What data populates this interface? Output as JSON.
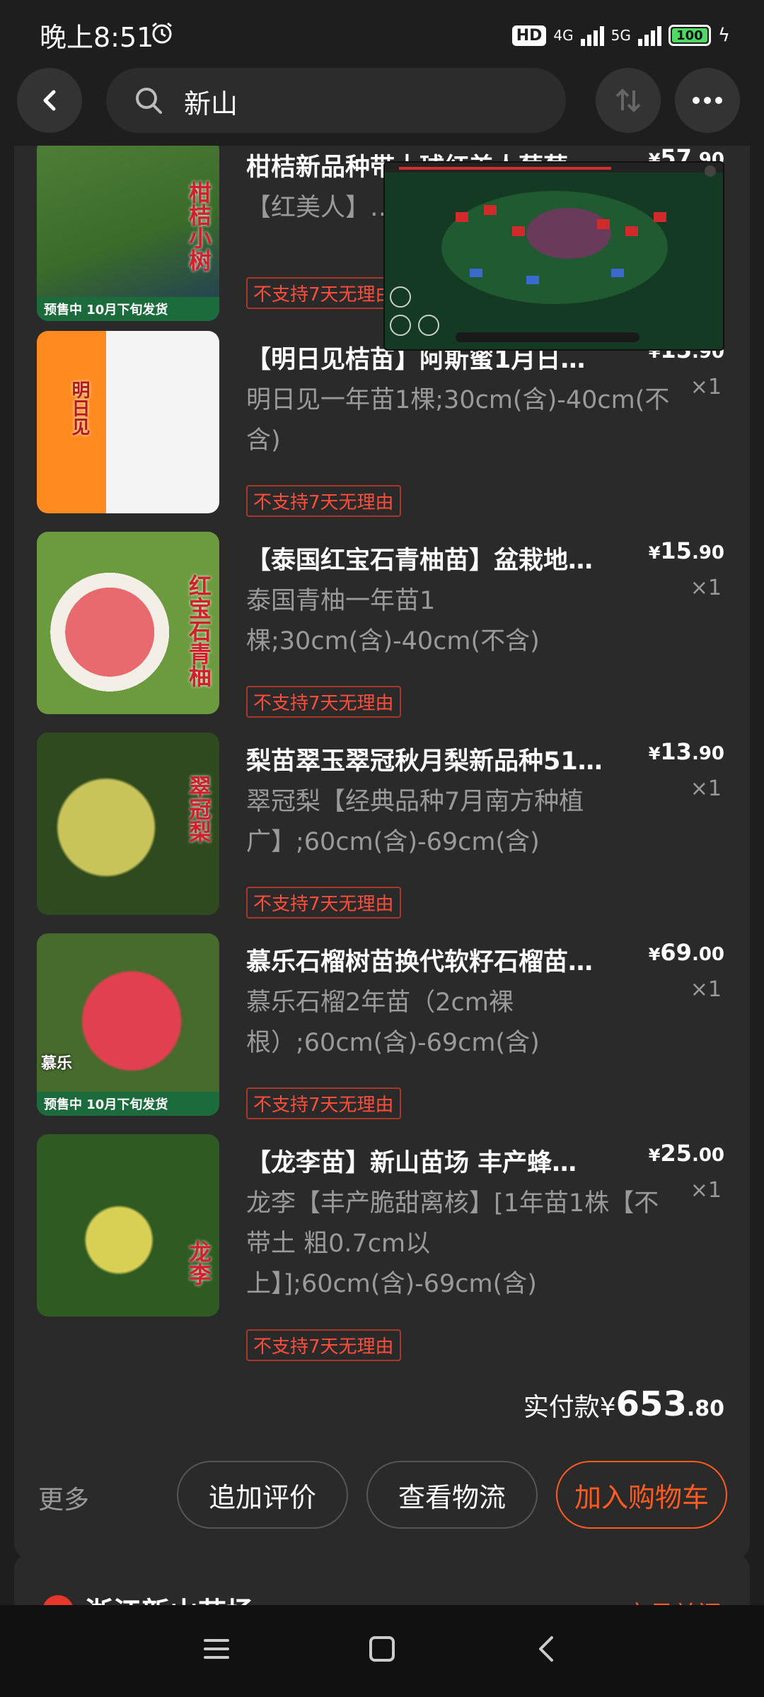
{
  "status": {
    "time": "晚上8:51",
    "hd": "HD",
    "net1": "4G",
    "net2": "5G",
    "battery": "100"
  },
  "search": {
    "query": "新山"
  },
  "items": [
    {
      "title": "柑桔新品种带土球红美人葡萄",
      "spec": "【红美人】…根;50cm(含)",
      "badge": "不支持7天无理由",
      "price_int": "57",
      "price_dec": ".90",
      "qty": "",
      "thumb_text": "柑桔小树",
      "presale": "预售中 10月下旬发货",
      "thumb_colors": [
        "#3e6b2c",
        "#1f3a5a"
      ]
    },
    {
      "title": "【明日见桔苗】阿斯蜜1月日…",
      "spec": "明日见一年苗1棵;30cm(含)-40cm(不含)",
      "badge": "不支持7天无理由",
      "price_int": "15",
      "price_dec": ".90",
      "qty": "×1",
      "thumb_text": "明日见",
      "presale": "",
      "thumb_colors": [
        "#f2f2f2",
        "#ff8a1f"
      ]
    },
    {
      "title": "【泰国红宝石青柚苗】盆栽地…",
      "spec": "泰国青柚一年苗1棵;30cm(含)-40cm(不含)",
      "badge": "不支持7天无理由",
      "price_int": "15",
      "price_dec": ".90",
      "qty": "×1",
      "thumb_text": "红宝石青柚",
      "presale": "",
      "thumb_colors": [
        "#e86a6e",
        "#5d8a3a"
      ]
    },
    {
      "title": "梨苗翠玉翠冠秋月梨新品种51…",
      "spec": "翠冠梨【经典品种7月南方种植广】;60cm(含)-69cm(含)",
      "badge": "不支持7天无理由",
      "price_int": "13",
      "price_dec": ".90",
      "qty": "×1",
      "thumb_text": "翠冠梨",
      "presale": "",
      "thumb_colors": [
        "#9aa23a",
        "#2f4a1e"
      ]
    },
    {
      "title": "慕乐石榴树苗换代软籽石榴苗…",
      "spec": "慕乐石榴2年苗（2cm裸根）;60cm(含)-69cm(含)",
      "badge": "不支持7天无理由",
      "price_int": "69",
      "price_dec": ".00",
      "qty": "×1",
      "thumb_text": "慕乐",
      "presale": "预售中 10月下旬发货",
      "thumb_colors": [
        "#d8394a",
        "#476b2d"
      ]
    },
    {
      "title": "【龙李苗】新山苗场 丰产蜂…",
      "spec": "龙李【丰产脆甜离核】[1年苗1株【不带土 粗0.7cm以上】];60cm(含)-69cm(含)",
      "badge": "不支持7天无理由",
      "price_int": "25",
      "price_dec": ".00",
      "qty": "×1",
      "thumb_text": "龙李",
      "presale": "",
      "thumb_colors": [
        "#c9c24a",
        "#2f5a22"
      ]
    }
  ],
  "total": {
    "label": "实付款",
    "currency": "¥",
    "amount": "653",
    "decimal": ".80"
  },
  "actions": {
    "more": "更多",
    "review": "追加评价",
    "logistics": "查看物流",
    "cart": "加入购物车"
  },
  "shop": {
    "name": "浙江新山苗场 ›",
    "status": "交易关闭"
  },
  "colors": {
    "accent": "#ff5a1f",
    "badge": "#ff4d3a",
    "background": "#1e1e1e",
    "card": "#2a2a2a"
  }
}
